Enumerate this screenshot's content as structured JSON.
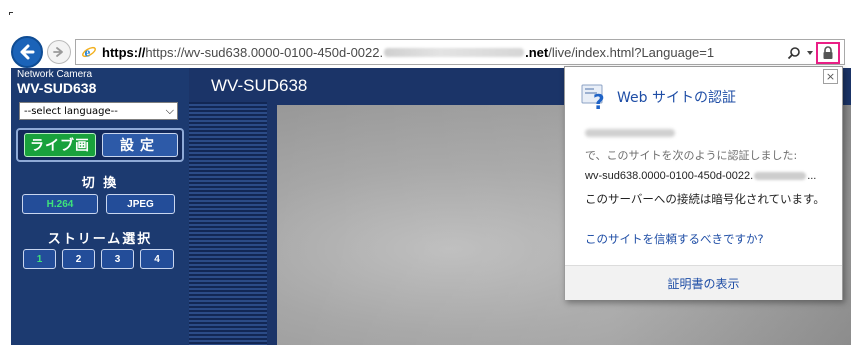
{
  "browser": {
    "url_prefix": "https://wv-sud638.0000-0100-450d-0022.",
    "url_domain_end": ".net",
    "url_path": "/live/index.html?Language=1"
  },
  "camera": {
    "header_sub": "Network Camera",
    "header_model": "WV-SUD638",
    "title": "WV-SUD638",
    "language_select": "--select language--",
    "mode_live": "ライブ画",
    "mode_setup": "設定",
    "switch_label": "切 換",
    "codec_buttons": [
      "H.264",
      "JPEG"
    ],
    "stream_label": "ストリーム選択",
    "stream_buttons": [
      "1",
      "2",
      "3",
      "4"
    ]
  },
  "popup": {
    "title": "Web サイトの認証",
    "verified_text": "で、このサイトを次のように認証しました:",
    "host_prefix": "wv-sud638.0000-0100-450d-0022.",
    "host_suffix": "...",
    "encrypted_text": "このサーバーへの接続は暗号化されています。",
    "trust_link": "このサイトを信頼するべきですか?",
    "view_cert_link": "証明書の表示",
    "close_glyph": "×"
  },
  "colors": {
    "lock_highlight": "#ea1f86",
    "link_blue": "#1f4ea6",
    "live_green": "#19a13c",
    "panel_navy": "#1c3a70"
  },
  "icons": [
    "back-arrow-icon",
    "forward-arrow-icon",
    "ie-logo-icon",
    "search-icon",
    "dropdown-arrow-icon",
    "lock-icon",
    "certificate-icon",
    "close-icon"
  ]
}
